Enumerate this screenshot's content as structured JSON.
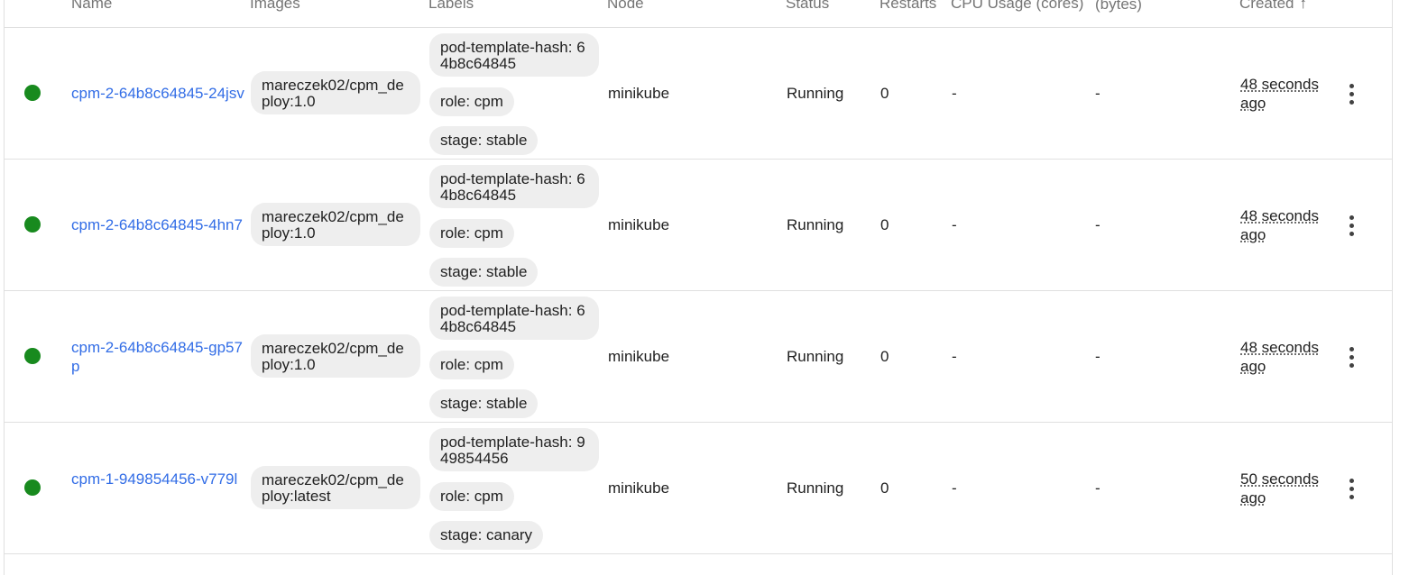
{
  "table": {
    "headers": {
      "name": "Name",
      "images": "Images",
      "labels": "Labels",
      "node": "Node",
      "status": "Status",
      "restarts": "Restarts",
      "cpu": "CPU Usage (cores)",
      "memory": "Memory Usage (bytes)",
      "created": "Created",
      "created_sort_icon": "arrow-up-icon"
    },
    "rows": [
      {
        "name": "cpm-2-64b8c64845-24jsv",
        "image": "mareczek02/cpm_deploy:1.0",
        "labels": [
          "pod-template-hash: 64b8c64845",
          "role: cpm",
          "stage: stable"
        ],
        "node": "minikube",
        "status": "Running",
        "restarts": "0",
        "cpu": "-",
        "memory": "-",
        "created": "48 seconds ago"
      },
      {
        "name": "cpm-2-64b8c64845-4hn7",
        "image": "mareczek02/cpm_deploy:1.0",
        "labels": [
          "pod-template-hash: 64b8c64845",
          "role: cpm",
          "stage: stable"
        ],
        "node": "minikube",
        "status": "Running",
        "restarts": "0",
        "cpu": "-",
        "memory": "-",
        "created": "48 seconds ago"
      },
      {
        "name": "cpm-2-64b8c64845-gp57p",
        "image": "mareczek02/cpm_deploy:1.0",
        "labels": [
          "pod-template-hash: 64b8c64845",
          "role: cpm",
          "stage: stable"
        ],
        "node": "minikube",
        "status": "Running",
        "restarts": "0",
        "cpu": "-",
        "memory": "-",
        "created": "48 seconds ago"
      },
      {
        "name": "cpm-1-949854456-v779l",
        "image": "mareczek02/cpm_deploy:latest",
        "labels": [
          "pod-template-hash: 949854456",
          "role: cpm",
          "stage: canary"
        ],
        "node": "minikube",
        "status": "Running",
        "restarts": "0",
        "cpu": "-",
        "memory": "-",
        "created": "50 seconds ago"
      }
    ]
  },
  "colors": {
    "status_ok": "#188a1e",
    "link": "#326de6"
  }
}
